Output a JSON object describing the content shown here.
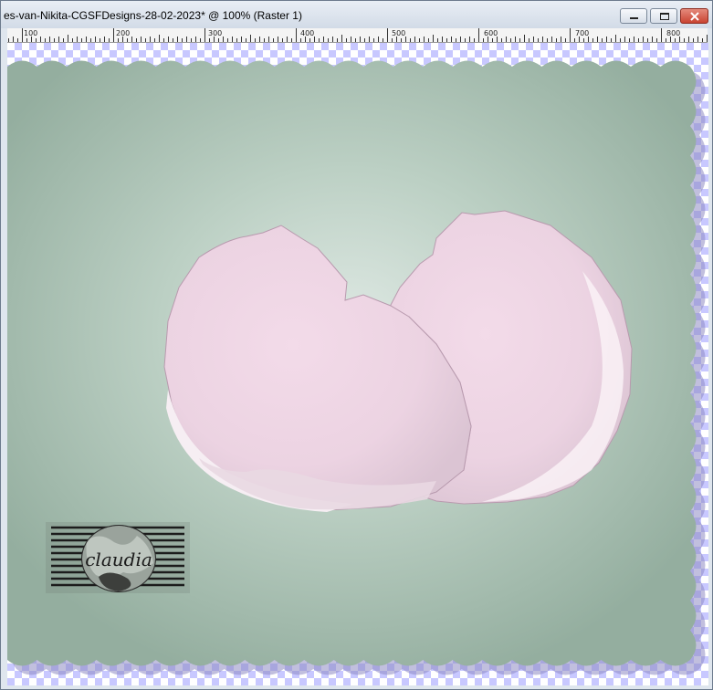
{
  "window": {
    "title": "es-van-Nikita-CGSFDesigns-28-02-2023* @ 100% (Raster 1)",
    "buttons": [
      "minimize",
      "maximize",
      "close"
    ]
  },
  "ruler": {
    "labels": [
      "100",
      "200",
      "300",
      "400",
      "500",
      "600",
      "700",
      "800"
    ]
  },
  "canvas": {
    "transparency_color": "#c8c8ff",
    "stamp_color": "#a9c2b3",
    "shell_color": "#f1dbe8"
  },
  "watermark": {
    "text": "claudia",
    "icon": "claudia-logo-stamp"
  }
}
